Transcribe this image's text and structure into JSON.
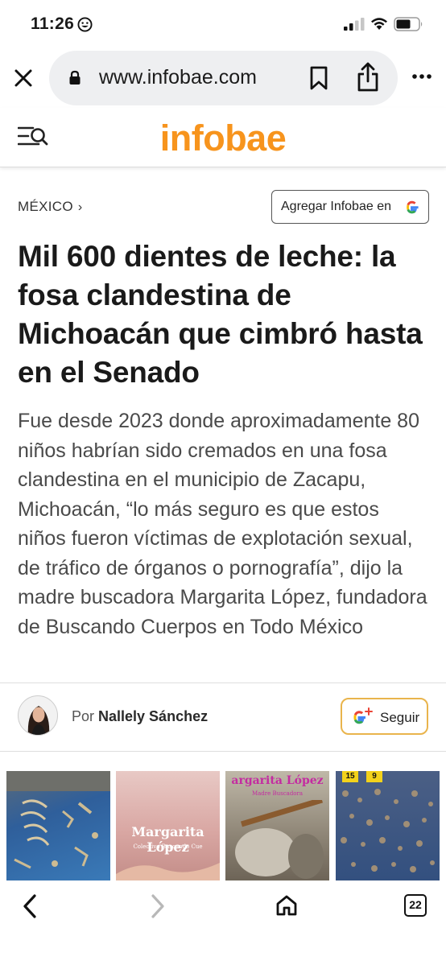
{
  "status_bar": {
    "time": "11:26"
  },
  "browser": {
    "url": "www.infobae.com",
    "icons": [
      "close-icon",
      "lock-icon",
      "bookmark-icon",
      "share-icon",
      "more-icon"
    ]
  },
  "site": {
    "logo": "infobae",
    "brand_color": "#f7941d"
  },
  "section": {
    "label": "MÉXICO",
    "chevron": "›",
    "google_button_label": "Agregar Infobae en"
  },
  "article": {
    "headline": "Mil 600 dientes de leche: la fosa clandestina de Michoacán que cimbró hasta en el Senado",
    "subheadline": "Fue desde 2023 donde aproximadamente 80 niños habrían sido cremados en una fosa clandestina en el municipio de Zacapu, Michoacán, “lo más seguro es que estos niños fueron víctimas de explotación sexual, de tráfico de órganos o pornografía”, dijo la madre buscadora Margarita López, fundadora de Buscando Cuerpos en Todo México"
  },
  "author": {
    "prefix": "Por",
    "name": "Nallely Sánchez",
    "follow_label": "Seguir"
  },
  "gallery": {
    "thumb2_caption": "Margarita López",
    "thumb2_sub": "Colectivo Buscando Cue",
    "thumb3_caption": "argarita López",
    "thumb3_sub": "Madre Buscadora",
    "thumb4_tags": [
      "15",
      "9"
    ]
  },
  "toolbar": {
    "tab_count": "22"
  }
}
